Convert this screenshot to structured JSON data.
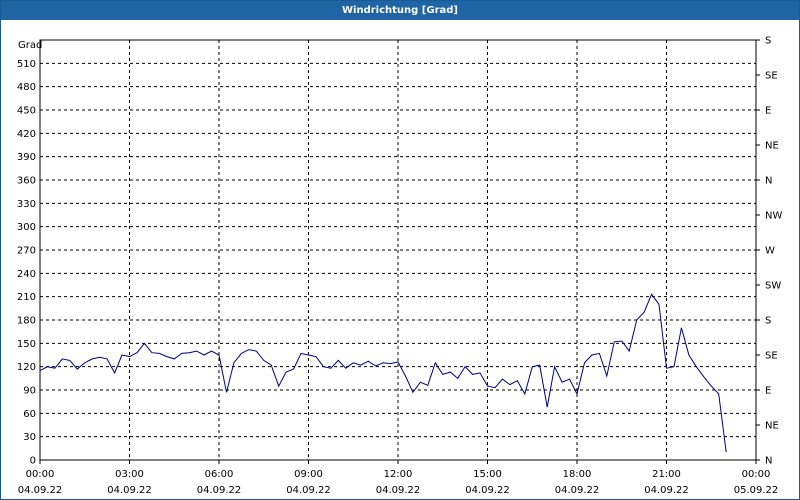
{
  "window": {
    "title": "Windrichtung [Grad]"
  },
  "chart_data": {
    "type": "line",
    "title": "Windrichtung [Grad]",
    "ylabel": "Grad",
    "ylim": [
      0,
      540
    ],
    "yticks": [
      0,
      30,
      60,
      90,
      120,
      150,
      180,
      210,
      240,
      270,
      300,
      330,
      360,
      390,
      420,
      450,
      480,
      510
    ],
    "xlim": [
      0,
      24
    ],
    "xticks": [
      {
        "time": "00:00",
        "date": "04.09.22",
        "h": 0
      },
      {
        "time": "03:00",
        "date": "04.09.22",
        "h": 3
      },
      {
        "time": "06:00",
        "date": "04.09.22",
        "h": 6
      },
      {
        "time": "09:00",
        "date": "04.09.22",
        "h": 9
      },
      {
        "time": "12:00",
        "date": "04.09.22",
        "h": 12
      },
      {
        "time": "15:00",
        "date": "04.09.22",
        "h": 15
      },
      {
        "time": "18:00",
        "date": "04.09.22",
        "h": 18
      },
      {
        "time": "21:00",
        "date": "04.09.22",
        "h": 21
      },
      {
        "time": "00:00",
        "date": "05.09.22",
        "h": 24
      }
    ],
    "right_axis_labels": [
      {
        "value": 0,
        "label": "N"
      },
      {
        "value": 45,
        "label": "NE"
      },
      {
        "value": 90,
        "label": "E"
      },
      {
        "value": 135,
        "label": "SE"
      },
      {
        "value": 180,
        "label": "S"
      },
      {
        "value": 225,
        "label": "SW"
      },
      {
        "value": 270,
        "label": "W"
      },
      {
        "value": 315,
        "label": "NW"
      },
      {
        "value": 360,
        "label": "N"
      },
      {
        "value": 405,
        "label": "NE"
      },
      {
        "value": 450,
        "label": "E"
      },
      {
        "value": 495,
        "label": "SE"
      },
      {
        "value": 540,
        "label": "S"
      }
    ],
    "grid": true,
    "series": [
      {
        "color": "#00008b",
        "points": [
          [
            0.0,
            115
          ],
          [
            0.25,
            120
          ],
          [
            0.5,
            118
          ],
          [
            0.75,
            130
          ],
          [
            1.0,
            128
          ],
          [
            1.25,
            117
          ],
          [
            1.5,
            125
          ],
          [
            1.75,
            130
          ],
          [
            2.0,
            132
          ],
          [
            2.25,
            130
          ],
          [
            2.5,
            112
          ],
          [
            2.75,
            135
          ],
          [
            3.0,
            133
          ],
          [
            3.25,
            138
          ],
          [
            3.5,
            150
          ],
          [
            3.75,
            138
          ],
          [
            4.0,
            137
          ],
          [
            4.25,
            133
          ],
          [
            4.5,
            130
          ],
          [
            4.75,
            137
          ],
          [
            5.0,
            138
          ],
          [
            5.25,
            140
          ],
          [
            5.5,
            135
          ],
          [
            5.75,
            140
          ],
          [
            6.0,
            135
          ],
          [
            6.25,
            87
          ],
          [
            6.5,
            125
          ],
          [
            6.75,
            137
          ],
          [
            7.0,
            142
          ],
          [
            7.25,
            140
          ],
          [
            7.5,
            128
          ],
          [
            7.75,
            122
          ],
          [
            8.0,
            95
          ],
          [
            8.25,
            113
          ],
          [
            8.5,
            117
          ],
          [
            8.75,
            137
          ],
          [
            9.0,
            135
          ],
          [
            9.25,
            133
          ],
          [
            9.5,
            120
          ],
          [
            9.75,
            118
          ],
          [
            10.0,
            128
          ],
          [
            10.25,
            118
          ],
          [
            10.5,
            125
          ],
          [
            10.75,
            122
          ],
          [
            11.0,
            127
          ],
          [
            11.25,
            121
          ],
          [
            11.5,
            125
          ],
          [
            11.75,
            124
          ],
          [
            12.0,
            126
          ],
          [
            12.25,
            108
          ],
          [
            12.5,
            87
          ],
          [
            12.75,
            100
          ],
          [
            13.0,
            96
          ],
          [
            13.25,
            125
          ],
          [
            13.5,
            110
          ],
          [
            13.75,
            113
          ],
          [
            14.0,
            105
          ],
          [
            14.25,
            120
          ],
          [
            14.5,
            110
          ],
          [
            14.75,
            112
          ],
          [
            15.0,
            95
          ],
          [
            15.25,
            93
          ],
          [
            15.5,
            104
          ],
          [
            15.75,
            97
          ],
          [
            16.0,
            102
          ],
          [
            16.25,
            85
          ],
          [
            16.5,
            120
          ],
          [
            16.75,
            122
          ],
          [
            17.0,
            68
          ],
          [
            17.25,
            120
          ],
          [
            17.5,
            100
          ],
          [
            17.75,
            104
          ],
          [
            18.0,
            85
          ],
          [
            18.25,
            125
          ],
          [
            18.5,
            135
          ],
          [
            18.75,
            137
          ],
          [
            19.0,
            108
          ],
          [
            19.25,
            152
          ],
          [
            19.5,
            153
          ],
          [
            19.75,
            140
          ],
          [
            20.0,
            180
          ],
          [
            20.25,
            190
          ],
          [
            20.5,
            213
          ],
          [
            20.75,
            200
          ],
          [
            21.0,
            118
          ],
          [
            21.25,
            120
          ],
          [
            21.5,
            170
          ],
          [
            21.75,
            135
          ],
          [
            22.0,
            120
          ],
          [
            22.25,
            107
          ],
          [
            22.5,
            95
          ],
          [
            22.75,
            85
          ],
          [
            23.0,
            10
          ]
        ]
      }
    ]
  }
}
